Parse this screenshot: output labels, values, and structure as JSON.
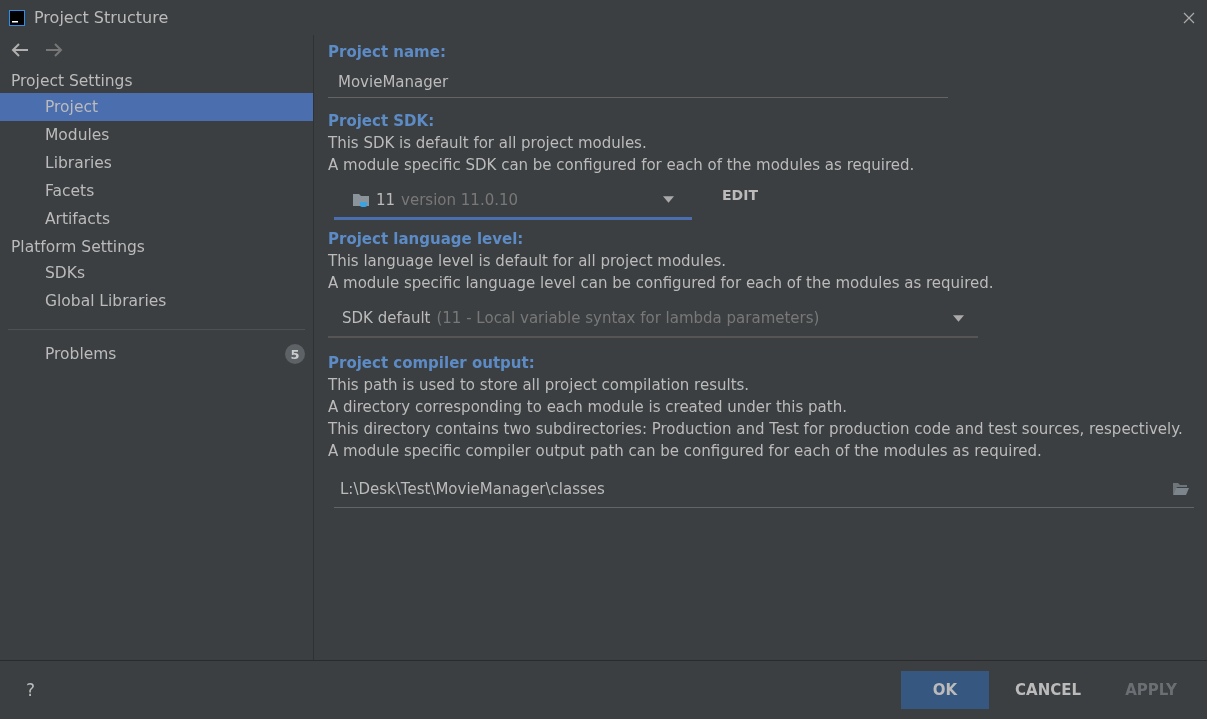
{
  "window": {
    "title": "Project Structure"
  },
  "sidebar": {
    "groups": [
      {
        "heading": "Project Settings",
        "items": [
          {
            "label": "Project",
            "selected": true
          },
          {
            "label": "Modules",
            "selected": false
          },
          {
            "label": "Libraries",
            "selected": false
          },
          {
            "label": "Facets",
            "selected": false
          },
          {
            "label": "Artifacts",
            "selected": false
          }
        ]
      },
      {
        "heading": "Platform Settings",
        "items": [
          {
            "label": "SDKs",
            "selected": false
          },
          {
            "label": "Global Libraries",
            "selected": false
          }
        ]
      }
    ],
    "problems": {
      "label": "Problems",
      "count": "5",
      "selected": false
    }
  },
  "main": {
    "project_name": {
      "label": "Project name:",
      "value": "MovieManager"
    },
    "project_sdk": {
      "label": "Project SDK:",
      "description": [
        "This SDK is default for all project modules.",
        "A module specific SDK can be configured for each of the modules as required."
      ],
      "value": "11",
      "detail": "version 11.0.10",
      "edit_button": "EDIT"
    },
    "language_level": {
      "label": "Project language level:",
      "description": [
        "This language level is default for all project modules.",
        "A module specific language level can be configured for each of the modules as required."
      ],
      "value": "SDK default",
      "detail": "(11 - Local variable syntax for lambda parameters)"
    },
    "compiler_output": {
      "label": "Project compiler output:",
      "description": [
        "This path is used to store all project compilation results.",
        "A directory corresponding to each module is created under this path.",
        "This directory contains two subdirectories: Production and Test for production code and test sources, respectively.",
        "A module specific compiler output path can be configured for each of the modules as required."
      ],
      "value": "L:\\Desk\\Test\\MovieManager\\classes"
    }
  },
  "footer": {
    "help": "?",
    "buttons": [
      {
        "label": "OK",
        "default": true,
        "disabled": false
      },
      {
        "label": "CANCEL",
        "default": false,
        "disabled": false
      },
      {
        "label": "APPLY",
        "default": false,
        "disabled": true
      }
    ]
  }
}
